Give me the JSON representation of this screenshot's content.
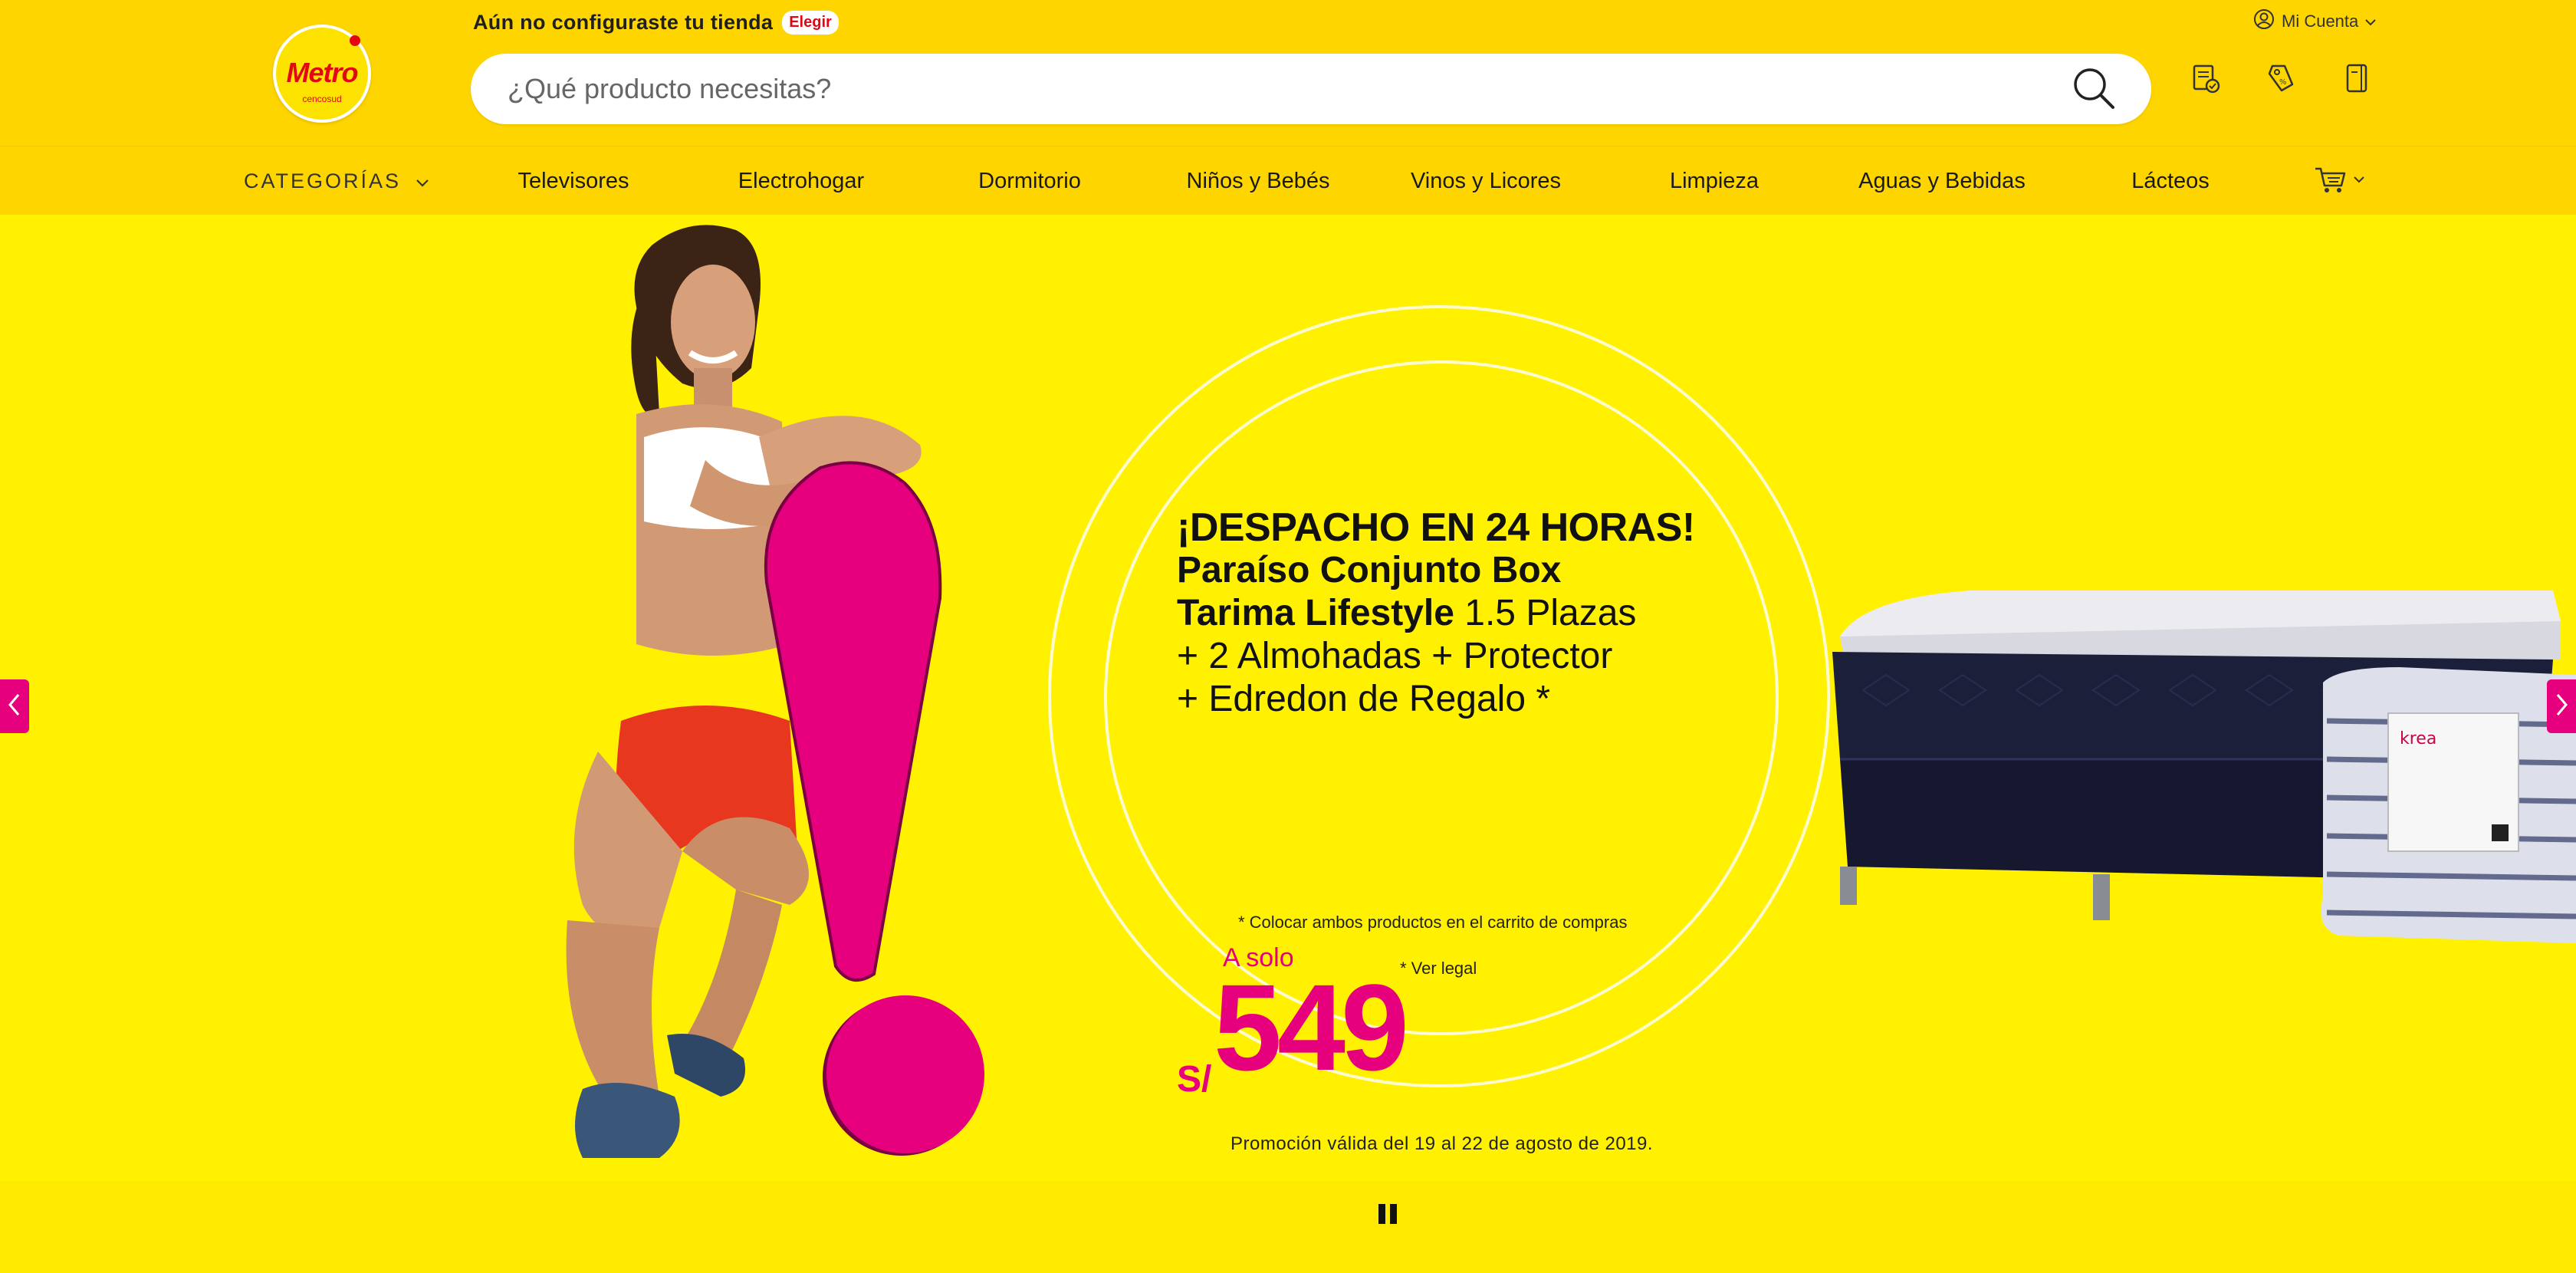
{
  "header": {
    "logo": {
      "word": "Metro",
      "sub": "cencosud"
    },
    "store_prompt": "Aún no configuraste tu tienda",
    "store_choose": "Elegir",
    "account_label": "Mi Cuenta",
    "search_placeholder": "¿Qué producto necesitas?",
    "icons": [
      "orders-icon",
      "coupon-tag-icon",
      "list-icon"
    ]
  },
  "nav": {
    "categories_label": "CATEGORÍAS",
    "items": [
      "Televisores",
      "Electrohogar",
      "Dormitorio",
      "Niños y Bebés",
      "Vinos y Licores",
      "Limpieza",
      "Aguas y Bebidas",
      "Lácteos"
    ]
  },
  "banner": {
    "headline": "¡DESPACHO EN 24 HORAS!",
    "product_line1": "Paraíso Conjunto Box",
    "product_line2_bold": "Tarima Lifestyle",
    "product_line2_rest": "1.5 Plazas",
    "product_line3": "+ 2 Almohadas + Protector",
    "product_line4": "+ Edredon de Regalo *",
    "price_prefix": "A solo",
    "currency": "S/",
    "price": "549",
    "note_cart": "* Colocar ambos productos en el carrito de compras",
    "note_legal": "* Ver legal",
    "validity": "Promoción válida del 19 al 22 de agosto de 2019.",
    "pillow_brand": "krea"
  },
  "colors": {
    "header_bg": "#ffd500",
    "banner_bg": "#fff100",
    "brand_magenta": "#e6007e",
    "brand_red": "#e30613"
  }
}
